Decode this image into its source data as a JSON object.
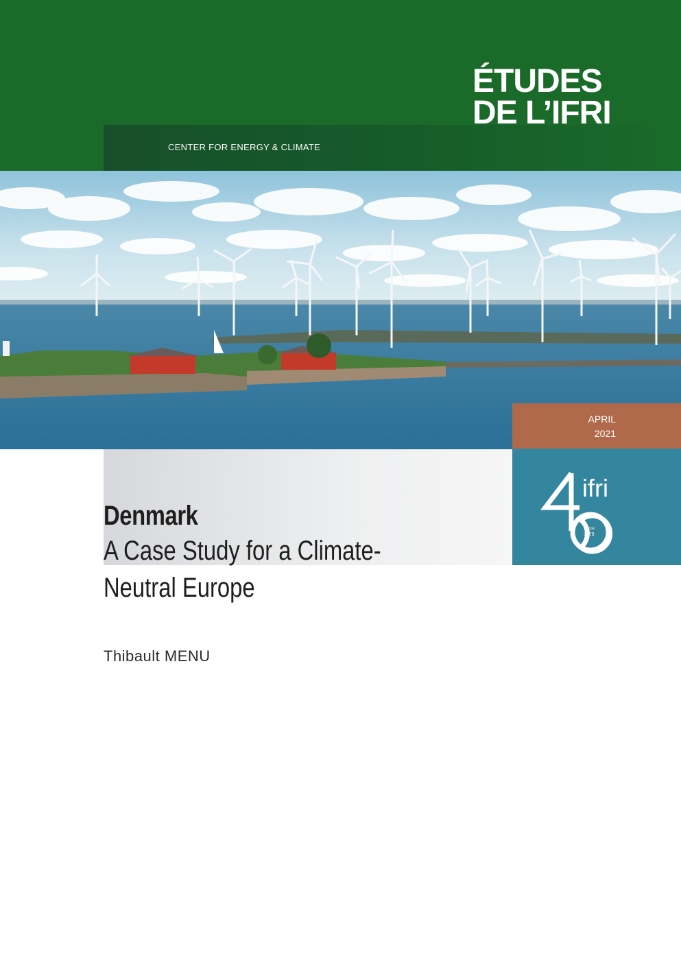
{
  "header": {
    "series_title": "ÉTUDES\nDE L’IFRI",
    "center_label": "CENTER FOR ENERGY & CLIMATE"
  },
  "cover_image": {
    "icon": "offshore-wind-farm-photo"
  },
  "date": {
    "month": "APRIL",
    "year": "2021"
  },
  "logo": {
    "name": "ifri",
    "numeral": "40",
    "since": "since",
    "founded": "1979"
  },
  "document": {
    "title": "Denmark",
    "subtitle": "A Case Study for a Climate-\nNeutral Europe",
    "author": "Thibault MENU"
  },
  "colors": {
    "header_green": "#1a6b2a",
    "date_terracotta": "#b06a4b",
    "logo_teal": "#34859e"
  }
}
